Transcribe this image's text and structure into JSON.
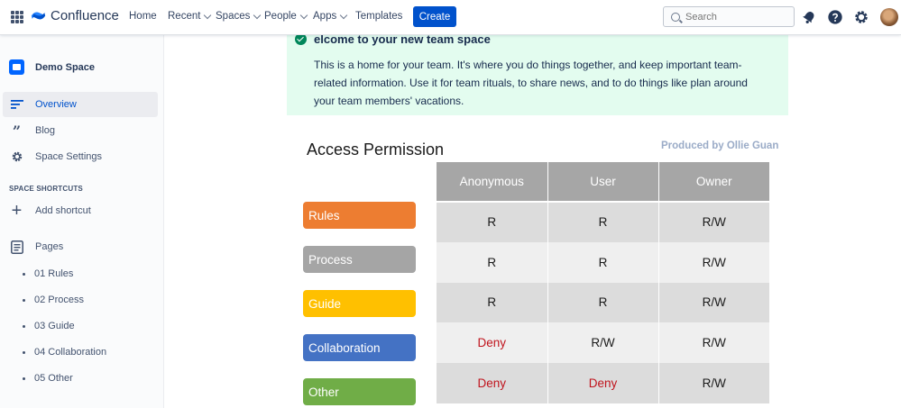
{
  "nav": {
    "brand": "Confluence",
    "home": "Home",
    "recent": "Recent",
    "spaces": "Spaces",
    "people": "People",
    "apps": "Apps",
    "templates": "Templates",
    "create": "Create",
    "search_placeholder": "Search"
  },
  "sidebar": {
    "space_name": "Demo Space",
    "items": [
      {
        "label": "Overview",
        "icon": "overview-icon"
      },
      {
        "label": "Blog",
        "icon": "quote-icon"
      },
      {
        "label": "Space Settings",
        "icon": "gear-icon"
      }
    ],
    "shortcuts_heading": "SPACE SHORTCUTS",
    "add_shortcut": "Add shortcut",
    "pages_label": "Pages",
    "pages": [
      "01 Rules",
      "02 Process",
      "03 Guide",
      "04 Collaboration",
      "05 Other"
    ]
  },
  "content": {
    "welcome_title": "elcome to your new team space",
    "welcome_body": "This is a home for your team. It's where you do things together, and keep important team-related information. Use it for team rituals, to share news, and to do things like plan around your team members' vacations.",
    "access_title": "Access Permission",
    "produced_by": "Produced by Ollie Guan"
  },
  "permissions": {
    "columns": [
      "Anonymous",
      "User",
      "Owner"
    ],
    "rows": [
      {
        "role": "Rules",
        "color": "#ed7d31",
        "values": [
          "R",
          "R",
          "R/W"
        ]
      },
      {
        "role": "Process",
        "color": "#a5a5a5",
        "values": [
          "R",
          "R",
          "R/W"
        ]
      },
      {
        "role": "Guide",
        "color": "#ffc000",
        "values": [
          "R",
          "R",
          "R/W"
        ]
      },
      {
        "role": "Collaboration",
        "color": "#4472c4",
        "values": [
          "Deny",
          "R/W",
          "R/W"
        ]
      },
      {
        "role": "Other",
        "color": "#70ad47",
        "values": [
          "Deny",
          "Deny",
          "R/W"
        ]
      }
    ]
  },
  "colors": {
    "accent": "#0052cc",
    "welcome_bg": "#e3fcef",
    "deny": "#c0141d"
  }
}
